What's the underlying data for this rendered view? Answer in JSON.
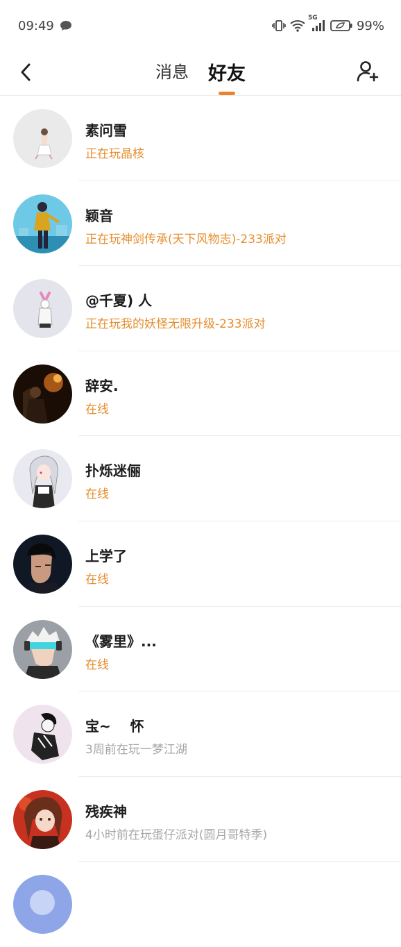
{
  "status_bar": {
    "time": "09:49",
    "network": "5G",
    "battery": "99%"
  },
  "header": {
    "tabs": [
      {
        "label": "消息"
      },
      {
        "label": "好友"
      }
    ]
  },
  "friends": [
    {
      "name": "素问雪",
      "status": "正在玩晶核"
    },
    {
      "name": "颖音",
      "status": "正在玩神剑传承(天下风物志)-233派对"
    },
    {
      "name": "@千夏) 人",
      "status": "正在玩我的妖怪无限升级-233派对"
    },
    {
      "name": "辞安.",
      "status": "在线"
    },
    {
      "name": "扑烁迷俪",
      "status": "在线"
    },
    {
      "name": "上学了",
      "status": "在线"
    },
    {
      "name": "《雾里》...",
      "status": "在线"
    },
    {
      "name": "宝~    怀",
      "status": "3周前在玩一梦江湖"
    },
    {
      "name": "残疾神",
      "status": "4小时前在玩蛋仔派对(圆月哥特季)"
    }
  ],
  "colors": {
    "accent": "#f0812b",
    "status_active": "#e58e2d",
    "status_idle": "#a6a6a6"
  }
}
